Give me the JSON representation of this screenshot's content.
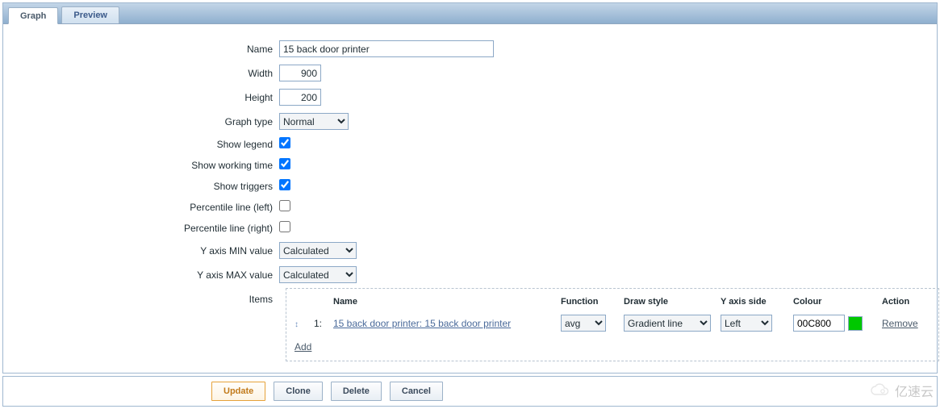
{
  "tabs": {
    "graph": "Graph",
    "preview": "Preview"
  },
  "form": {
    "name": {
      "label": "Name",
      "value": "15 back door printer"
    },
    "width": {
      "label": "Width",
      "value": "900"
    },
    "height": {
      "label": "Height",
      "value": "200"
    },
    "graphType": {
      "label": "Graph type",
      "value": "Normal"
    },
    "showLegend": {
      "label": "Show legend",
      "checked": true
    },
    "showWT": {
      "label": "Show working time",
      "checked": true
    },
    "showTrig": {
      "label": "Show triggers",
      "checked": true
    },
    "pctLeft": {
      "label": "Percentile line (left)",
      "checked": false
    },
    "pctRight": {
      "label": "Percentile line (right)",
      "checked": false
    },
    "yMin": {
      "label": "Y axis MIN value",
      "value": "Calculated"
    },
    "yMax": {
      "label": "Y axis MAX value",
      "value": "Calculated"
    },
    "items": {
      "label": "Items"
    }
  },
  "itemsTable": {
    "headers": {
      "name": "Name",
      "func": "Function",
      "draw": "Draw style",
      "yside": "Y axis side",
      "colour": "Colour",
      "action": "Action"
    },
    "rows": [
      {
        "idx": "1:",
        "name": "15 back door printer: 15 back door printer",
        "func": "avg",
        "draw": "Gradient line",
        "yside": "Left",
        "colour": "00C800",
        "swatch": "#00C800",
        "action": "Remove"
      }
    ],
    "add": "Add"
  },
  "buttons": {
    "update": "Update",
    "clone": "Clone",
    "delete": "Delete",
    "cancel": "Cancel"
  },
  "watermark": "亿速云"
}
